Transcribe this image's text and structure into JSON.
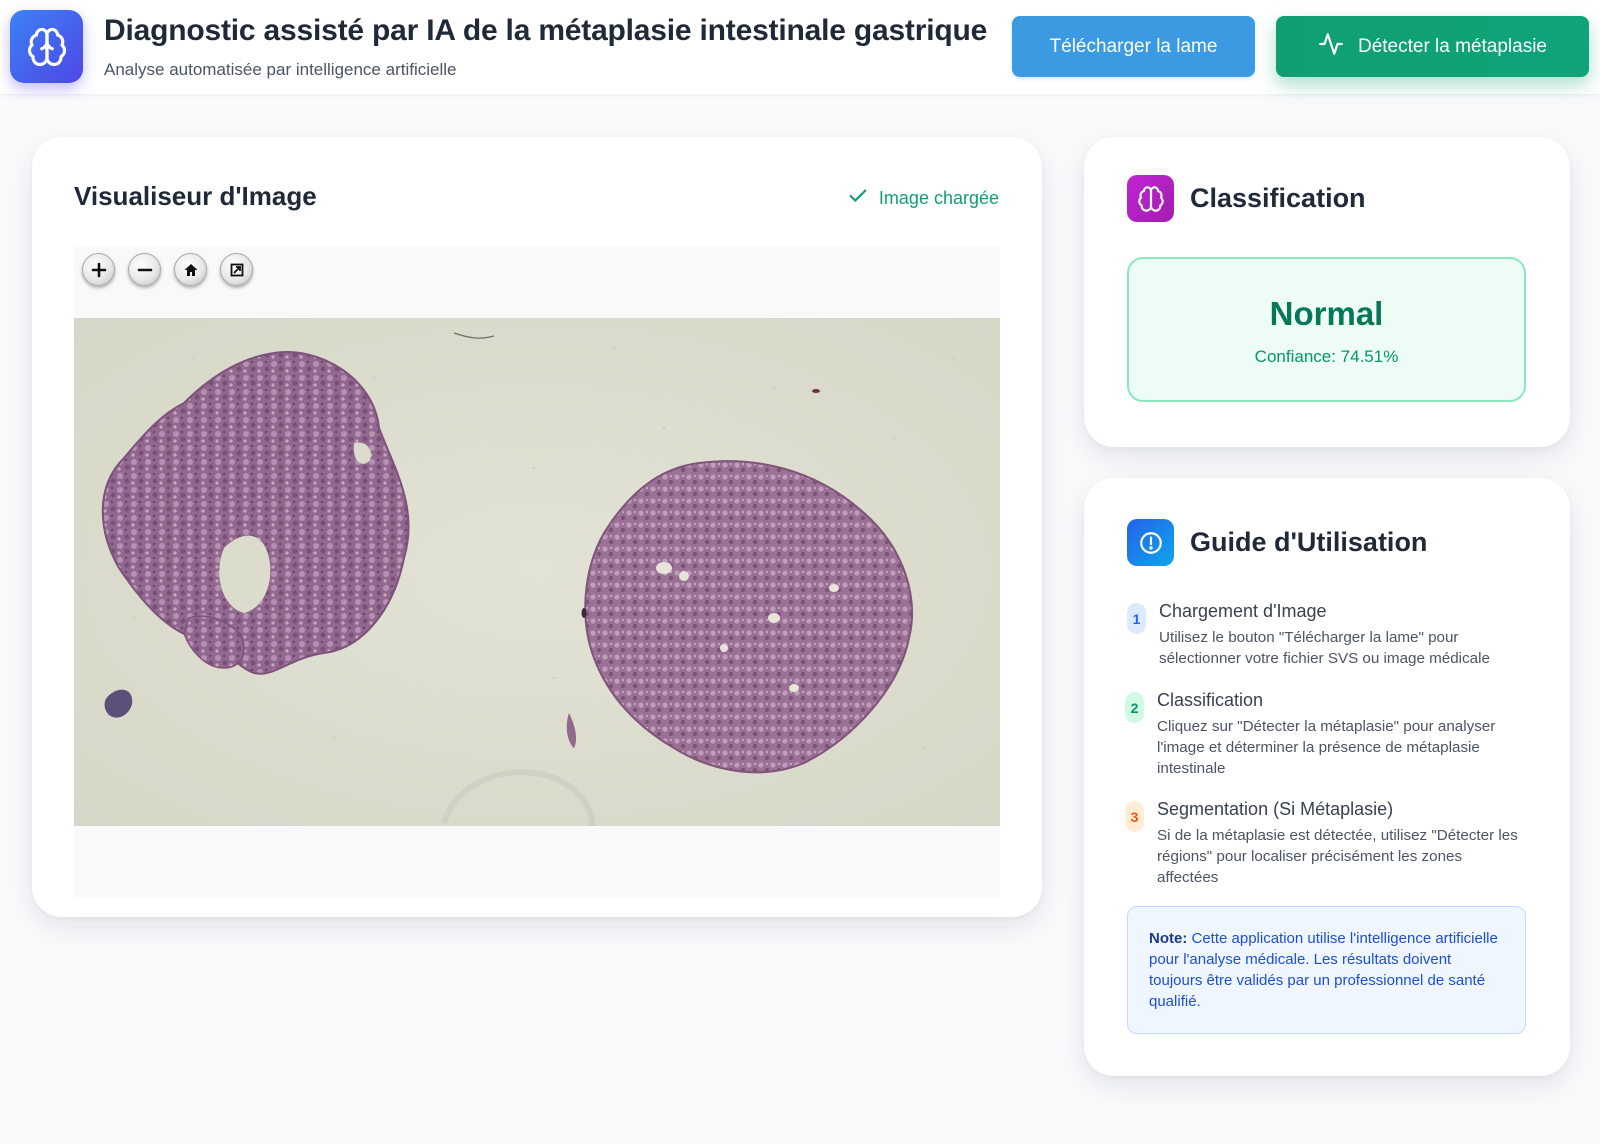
{
  "header": {
    "title": "Diagnostic assisté par IA de la métaplasie intestinale gastrique",
    "subtitle": "Analyse automatisée par intelligence artificielle",
    "upload_label": "Télécharger la lame",
    "detect_label": "Détecter la métaplasie",
    "logo_icon": "brain-icon",
    "detect_icon": "activity-icon"
  },
  "viewer": {
    "title": "Visualiseur d'Image",
    "status": "Image chargée",
    "status_icon": "check-icon",
    "controls": [
      "zoom-in-icon",
      "zoom-out-icon",
      "home-icon",
      "fullscreen-icon"
    ]
  },
  "classification": {
    "title": "Classification",
    "icon": "brain-icon",
    "result": "Normal",
    "confidence": "Confiance: 74.51%"
  },
  "guide": {
    "title": "Guide d'Utilisation",
    "icon": "info-icon",
    "steps": [
      {
        "num": "1",
        "title": "Chargement d'Image",
        "desc": "Utilisez le bouton \"Télécharger la lame\" pour sélectionner votre fichier SVS ou image médicale"
      },
      {
        "num": "2",
        "title": "Classification",
        "desc": "Cliquez sur \"Détecter la métaplasie\" pour analyser l'image et déterminer la présence de métaplasie intestinale"
      },
      {
        "num": "3",
        "title": "Segmentation (Si Métaplasie)",
        "desc": "Si de la métaplasie est détectée, utilisez \"Détecter les régions\" pour localiser précisément les zones affectées"
      }
    ],
    "note_label": "Note:",
    "note_text": " Cette application utilise l'intelligence artificielle pour l'analyse médicale. Les résultats doivent toujours être validés par un professionnel de santé qualifié."
  },
  "colors": {
    "primary": "#3b9ae1",
    "success": "#0f9f72",
    "accent_purple": "#c026d3",
    "info_blue": "#1d4ed8"
  }
}
